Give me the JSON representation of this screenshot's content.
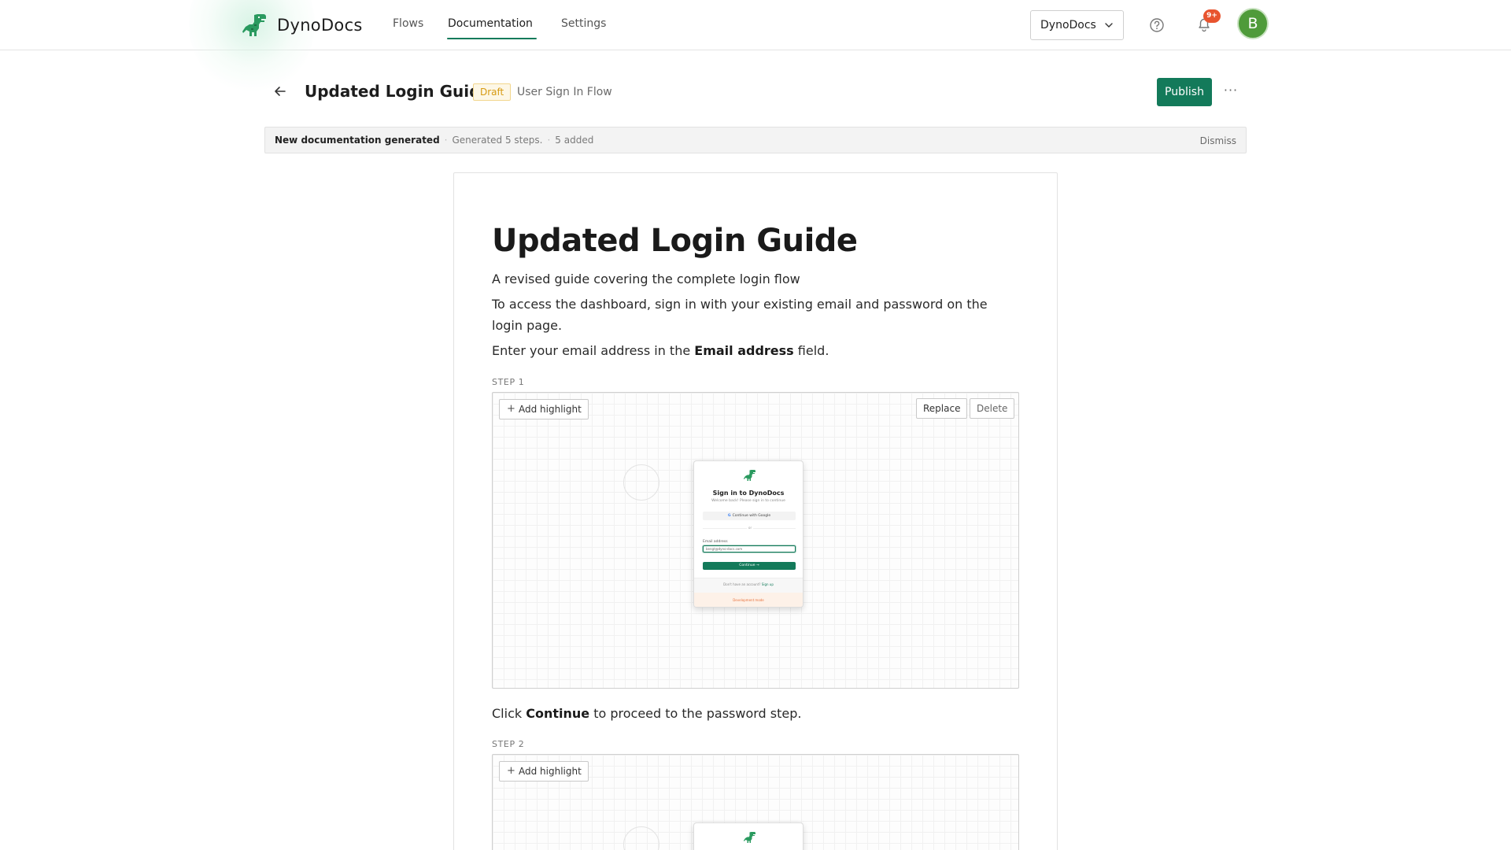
{
  "app": {
    "name": "DynoDocs"
  },
  "nav": {
    "items": [
      {
        "label": "Flows"
      },
      {
        "label": "Documentation"
      },
      {
        "label": "Settings"
      }
    ],
    "active": "Documentation",
    "workspace_select": "DynoDocs",
    "notifications_badge": "9+",
    "avatar_initial": "B"
  },
  "header": {
    "title": "Updated Login Guide",
    "status": "Draft",
    "flow_name": "User Sign In Flow",
    "publish_label": "Publish"
  },
  "banner": {
    "title": "New documentation generated",
    "generated": "Generated 5 steps.",
    "added": "5 added",
    "dismiss": "Dismiss"
  },
  "document": {
    "title": "Updated Login Guide",
    "subtitle": "A revised guide covering the complete login flow",
    "intro": "To access the dashboard, sign in with your existing email and password on the login page.",
    "step1_text_before": "Enter your email address in the ",
    "step1_text_bold": "Email address",
    "step1_text_after": " field.",
    "step1_label": "STEP 1",
    "step2_text_before": "Click ",
    "step2_text_bold": "Continue",
    "step2_text_after": " to proceed to the password step.",
    "step2_label": "STEP 2",
    "add_highlight": "Add highlight",
    "replace": "Replace",
    "delete": "Delete"
  },
  "screenshot_preview": {
    "title": "Sign in to DynoDocs",
    "subtitle": "Welcome back! Please sign in to continue",
    "google_button": "Continue with Google",
    "divider": "or",
    "email_label": "Email address",
    "email_value": "bengt@dyno-docs.com",
    "continue_button": "Continue →",
    "no_account": "Don't have an account?",
    "sign_up": "Sign up",
    "dev_mode": "Development mode"
  },
  "colors": {
    "accent": "#137a5a",
    "draft_badge": "#d69a12",
    "notification": "#e8542f",
    "avatar": "#4f9b3a"
  }
}
